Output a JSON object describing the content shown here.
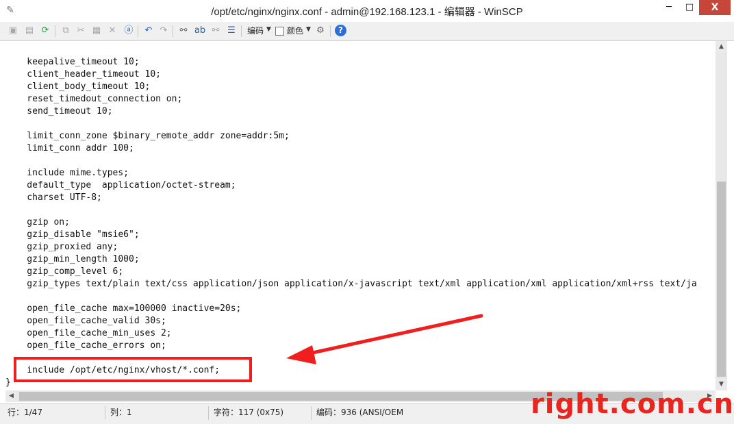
{
  "window": {
    "title": "/opt/etc/nginx/nginx.conf - admin@192.168.123.1 - 编辑器 - WinSCP",
    "minimize": "─",
    "maximize": "□",
    "close": "X"
  },
  "toolbar": {
    "encoding_label": "编码",
    "color_label": "颜色",
    "icons": [
      "save-icon",
      "save-all-icon",
      "reload-icon",
      "copy-icon",
      "cut-icon",
      "paste-icon",
      "delete-icon",
      "select-all-icon",
      "undo-icon",
      "redo-icon",
      "find-icon",
      "replace-icon",
      "find-next-icon",
      "goto-line-icon",
      "settings-icon",
      "help-icon"
    ]
  },
  "editor": {
    "lines": [
      "    keepalive_timeout 10;",
      "    client_header_timeout 10;",
      "    client_body_timeout 10;",
      "    reset_timedout_connection on;",
      "    send_timeout 10;",
      "",
      "    limit_conn_zone $binary_remote_addr zone=addr:5m;",
      "    limit_conn addr 100;",
      "",
      "    include mime.types;",
      "    default_type  application/octet-stream;",
      "    charset UTF-8;",
      "",
      "    gzip on;",
      "    gzip_disable \"msie6\";",
      "    gzip_proxied any;",
      "    gzip_min_length 1000;",
      "    gzip_comp_level 6;",
      "    gzip_types text/plain text/css application/json application/x-javascript text/xml application/xml application/xml+rss text/ja",
      "",
      "    open_file_cache max=100000 inactive=20s;",
      "    open_file_cache_valid 30s;",
      "    open_file_cache_min_uses 2;",
      "    open_file_cache_errors on;",
      "",
      "    include /opt/etc/nginx/vhost/*.conf;",
      "}"
    ]
  },
  "statusbar": {
    "line": "行：1/47",
    "column": "列：1",
    "char": "字符：117 (0x75)",
    "encoding": "编码：936    (ANSI/OEM"
  },
  "watermark": "right.com.cn",
  "colors": {
    "highlight": "#f01e1e",
    "watermark": "#e8261f"
  }
}
